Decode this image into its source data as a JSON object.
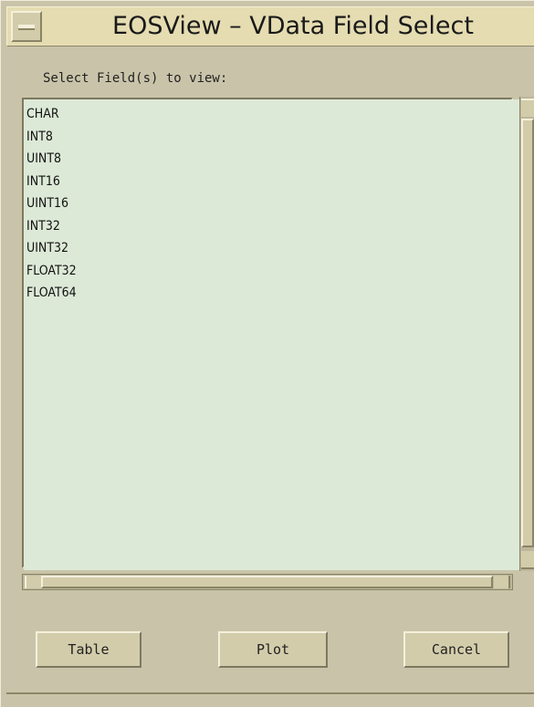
{
  "window": {
    "title": "EOSView – VData Field Select"
  },
  "prompt": "Select Field(s) to view:",
  "fields": [
    "CHAR",
    "INT8",
    "UINT8",
    "INT16",
    "UINT16",
    "INT32",
    "UINT32",
    "FLOAT32",
    "FLOAT64"
  ],
  "buttons": {
    "table": "Table",
    "plot": "Plot",
    "cancel": "Cancel"
  },
  "colors": {
    "background": "#c9c4a9",
    "titlebar": "#e5dcb1",
    "list_background": "#dde9d7"
  }
}
